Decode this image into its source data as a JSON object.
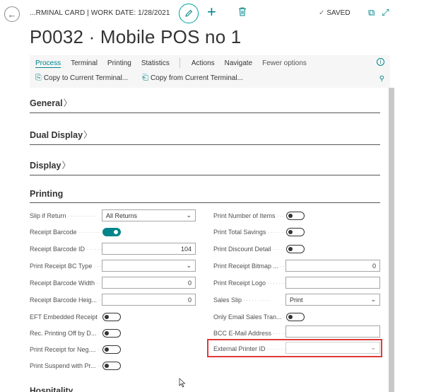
{
  "header": {
    "breadcrumb": "...RMINAL CARD | WORK DATE: 1/28/2021",
    "saved_label": "SAVED",
    "title": "P0032 · Mobile POS no 1"
  },
  "actionbar": {
    "menu": [
      "Process",
      "Terminal",
      "Printing",
      "Statistics",
      "Actions",
      "Navigate",
      "Fewer options"
    ],
    "sub_actions": [
      "Copy to Current Terminal...",
      "Copy from Current Terminal..."
    ]
  },
  "sections": {
    "general": "General",
    "dual_display": "Dual Display",
    "display": "Display",
    "printing": "Printing",
    "next": "Hospitality"
  },
  "left_fields": [
    {
      "label": "Slip if Return",
      "type": "select",
      "value": "All Returns"
    },
    {
      "label": "Receipt Barcode",
      "type": "toggle",
      "value": true
    },
    {
      "label": "Receipt Barcode ID",
      "type": "number",
      "value": "104"
    },
    {
      "label": "Print Receipt BC Type",
      "type": "select",
      "value": ""
    },
    {
      "label": "Receipt Barcode Width",
      "type": "number",
      "value": "0"
    },
    {
      "label": "Receipt Barcode Heig...",
      "type": "number",
      "value": "0"
    },
    {
      "label": "EFT Embedded Receipt",
      "type": "toggle",
      "value": false
    },
    {
      "label": "Rec. Printing Off by D...",
      "type": "toggle",
      "value": false
    },
    {
      "label": "Print Receipt for Neg....",
      "type": "toggle",
      "value": false
    },
    {
      "label": "Print Suspend with Pr...",
      "type": "toggle",
      "value": false
    }
  ],
  "right_fields": [
    {
      "label": "Print Number of Items",
      "type": "toggle",
      "value": false
    },
    {
      "label": "Print Total Savings",
      "type": "toggle",
      "value": false
    },
    {
      "label": "Print Discount Detail",
      "type": "toggle",
      "value": false
    },
    {
      "label": "Print Receipt Bitmap ...",
      "type": "number",
      "value": "0"
    },
    {
      "label": "Print Receipt Logo",
      "type": "text",
      "value": ""
    },
    {
      "label": "Sales Slip",
      "type": "select",
      "value": "Print"
    },
    {
      "label": "Only Email Sales Tran...",
      "type": "toggle",
      "value": false
    },
    {
      "label": "BCC E-Mail Address",
      "type": "text",
      "value": ""
    },
    {
      "label": "External Printer ID",
      "type": "lookup",
      "value": ""
    }
  ],
  "colors": {
    "accent": "#00858a",
    "highlight_border": "#e03a3a"
  }
}
